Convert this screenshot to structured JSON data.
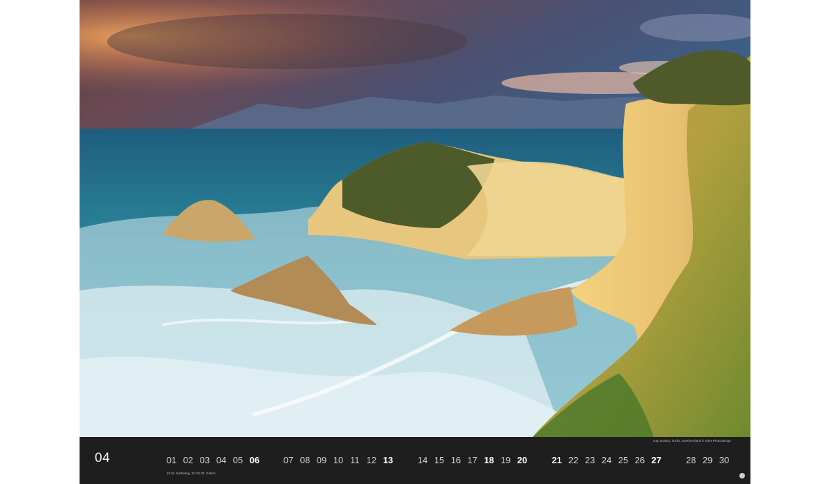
{
  "photo": {
    "caption": "Kap Drastis, Korfu, Griechenland © Eder Photodesign"
  },
  "calendar": {
    "month_number": "04",
    "holiday_note": "18.04. Karfreitag, 20./21.04. Ostern",
    "days": [
      {
        "label": "01",
        "bold": false
      },
      {
        "label": "02",
        "bold": false
      },
      {
        "label": "03",
        "bold": false
      },
      {
        "label": "04",
        "bold": false
      },
      {
        "label": "05",
        "bold": false
      },
      {
        "label": "06",
        "bold": true
      },
      {
        "label": "07",
        "bold": false
      },
      {
        "label": "08",
        "bold": false
      },
      {
        "label": "09",
        "bold": false
      },
      {
        "label": "10",
        "bold": false
      },
      {
        "label": "11",
        "bold": false
      },
      {
        "label": "12",
        "bold": false
      },
      {
        "label": "13",
        "bold": true
      },
      {
        "label": "14",
        "bold": false
      },
      {
        "label": "15",
        "bold": false
      },
      {
        "label": "16",
        "bold": false
      },
      {
        "label": "17",
        "bold": false
      },
      {
        "label": "18",
        "bold": true
      },
      {
        "label": "19",
        "bold": false
      },
      {
        "label": "20",
        "bold": true
      },
      {
        "label": "21",
        "bold": true
      },
      {
        "label": "22",
        "bold": false
      },
      {
        "label": "23",
        "bold": false
      },
      {
        "label": "24",
        "bold": false
      },
      {
        "label": "25",
        "bold": false
      },
      {
        "label": "26",
        "bold": false
      },
      {
        "label": "27",
        "bold": true
      },
      {
        "label": "28",
        "bold": false
      },
      {
        "label": "29",
        "bold": false
      },
      {
        "label": "30",
        "bold": false
      }
    ]
  },
  "colors": {
    "strip_background": "#1e1e1e",
    "day_text": "#d6d6d6",
    "emphasis_text": "#ffffff"
  },
  "icons": {
    "publisher_logo": "circle-logo-icon"
  }
}
